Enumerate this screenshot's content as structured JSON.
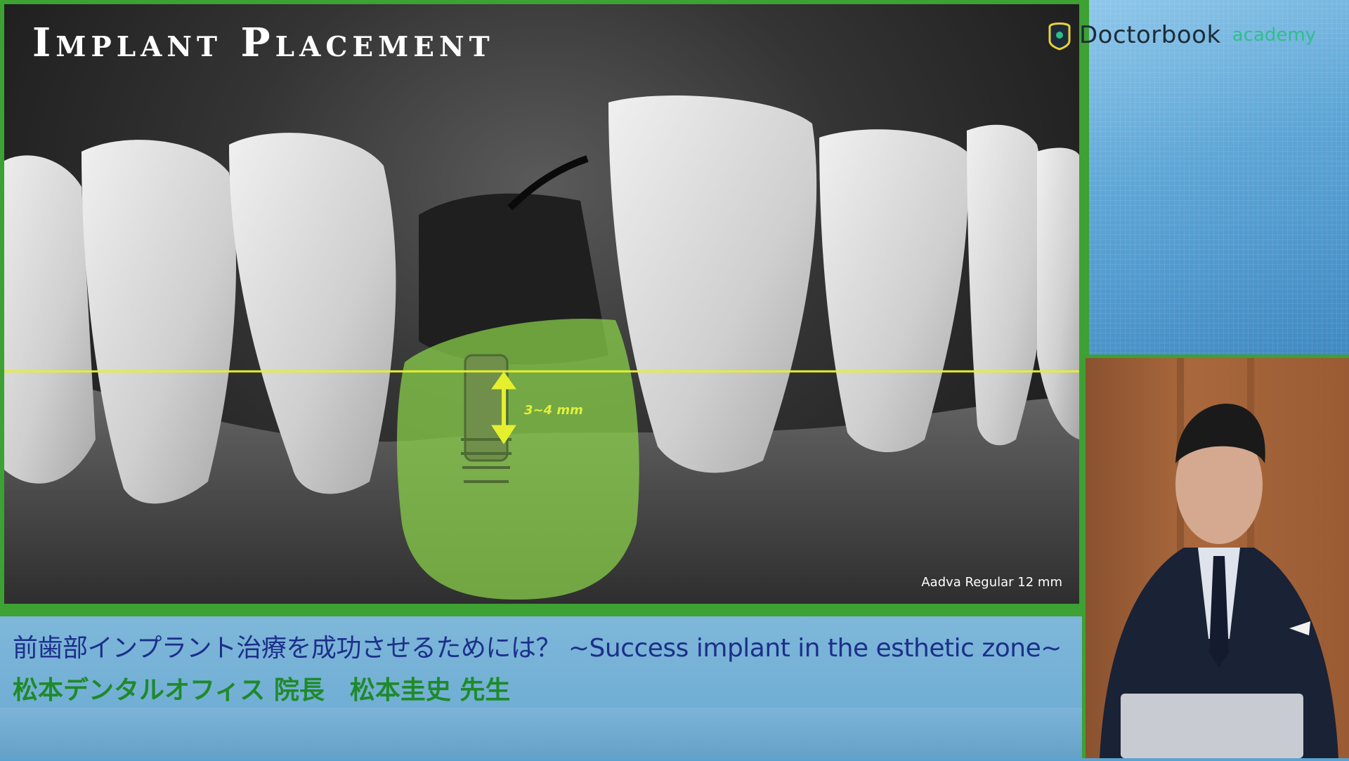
{
  "brand": {
    "name": "Doctorbook",
    "sub": "academy"
  },
  "slide": {
    "title": "Implant Placement",
    "measurement_label": "3~4 mm",
    "implant_caption": "Aadva Regular 12 mm"
  },
  "caption": {
    "title": "前歯部インプラント治療を成功させるためには？ ~Success implant in the esthetic zone~",
    "speaker": "松本デンタルオフィス 院長　松本圭史 先生"
  },
  "colors": {
    "frame_green": "#3da133",
    "title_blue": "#1c2f8a",
    "speaker_green": "#1e8a2a",
    "reference_line": "#e6ef2e",
    "overlay_green": "#8bd44a"
  }
}
